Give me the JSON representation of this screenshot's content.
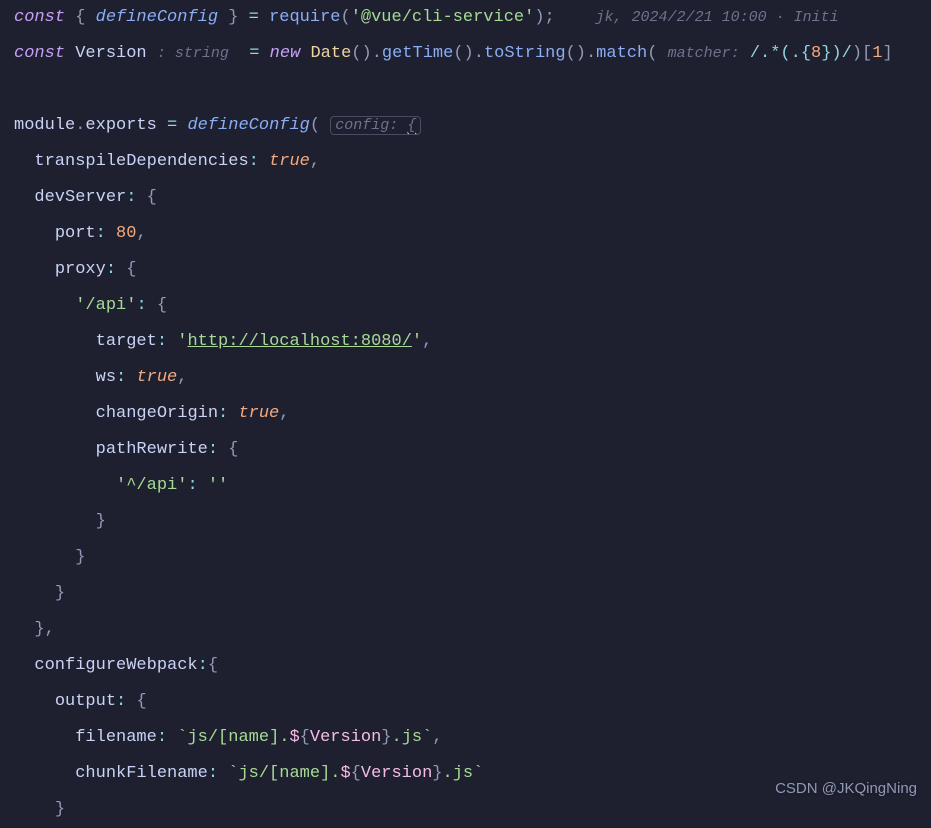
{
  "annotation": "jk, 2024/2/21 10:00 · Initi",
  "watermark": "CSDN @JKQingNing",
  "hints": {
    "string_type": ": string",
    "matcher": "matcher:",
    "config": "config:"
  },
  "code": {
    "l1": {
      "const": "const",
      "brace_o": "{",
      "defineConfig": "defineConfig",
      "brace_c": "}",
      "eq": "=",
      "require": "require",
      "paren_o": "(",
      "str": "'@vue/cli-service'",
      "paren_c": ")",
      "semi": ";"
    },
    "l2": {
      "const": "const",
      "Version": "Version",
      "eq": "=",
      "new": "new",
      "Date": "Date",
      "getTime": "getTime",
      "toString": "toString",
      "match": "match",
      "regex_a": "/.",
      "regex_star": "*",
      "regex_b": "(.{",
      "regex_8": "8",
      "regex_c": "})/",
      "bracket_o": "[",
      "idx": "1",
      "bracket_c": "]"
    },
    "l4": {
      "module": "module",
      "dot": ".",
      "exports": "exports",
      "eq": "=",
      "defineConfig": "defineConfig",
      "paren_o": "(",
      "brace": "{"
    },
    "l5": {
      "key": "transpileDependencies",
      "colon": ":",
      "val": "true",
      "comma": ","
    },
    "l6": {
      "key": "devServer",
      "colon": ":",
      "brace": "{"
    },
    "l7": {
      "key": "port",
      "colon": ":",
      "val": "80",
      "comma": ","
    },
    "l8": {
      "key": "proxy",
      "colon": ":",
      "brace": "{"
    },
    "l9": {
      "key": "'/api'",
      "colon": ":",
      "brace": "{"
    },
    "l10": {
      "key": "target",
      "colon": ":",
      "q": "'",
      "url": "http://localhost:8080/",
      "comma": ","
    },
    "l11": {
      "key": "ws",
      "colon": ":",
      "val": "true",
      "comma": ","
    },
    "l12": {
      "key": "changeOrigin",
      "colon": ":",
      "val": "true",
      "comma": ","
    },
    "l13": {
      "key": "pathRewrite",
      "colon": ":",
      "brace": "{"
    },
    "l14": {
      "key": "'^/api'",
      "colon": ":",
      "val": "''"
    },
    "l15": {
      "brace": "}"
    },
    "l16": {
      "brace": "}"
    },
    "l17": {
      "brace": "}"
    },
    "l18": {
      "brace": "}",
      "comma": ","
    },
    "l19": {
      "key": "configureWebpack",
      "colon": ":",
      "brace": "{"
    },
    "l20": {
      "key": "output",
      "colon": ":",
      "brace": "{"
    },
    "l21": {
      "key": "filename",
      "colon": ":",
      "tpl_a": "`js/[name].",
      "dollar": "$",
      "brace_o": "{",
      "Version": "Version",
      "brace_c": "}",
      "tpl_b": ".js`",
      "comma": ","
    },
    "l22": {
      "key": "chunkFilename",
      "colon": ":",
      "tpl_a": "`js/[name].",
      "dollar": "$",
      "brace_o": "{",
      "Version": "Version",
      "brace_c": "}",
      "tpl_b": ".js`"
    },
    "l23": {
      "brace": "}"
    }
  }
}
